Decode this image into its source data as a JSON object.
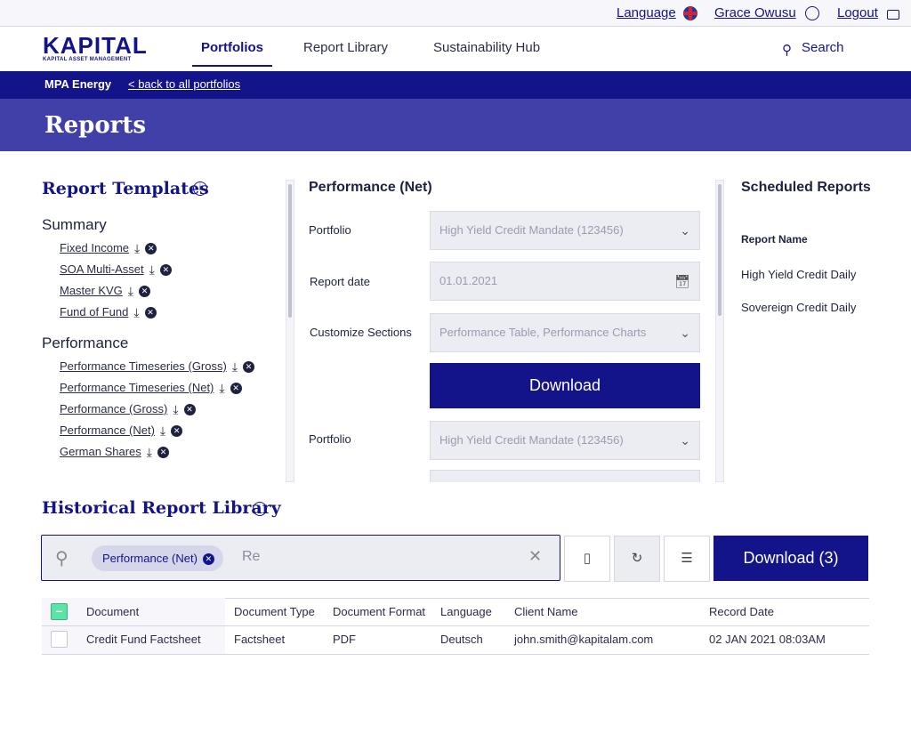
{
  "topbar": {
    "language": "Language",
    "user": "Grace Owusu",
    "logout": "Logout"
  },
  "nav": {
    "logo": "KAPITAL",
    "logo_sub": "KAPITAL ASSET MANAGEMENT",
    "items": [
      "Portfolios",
      "Report Library",
      "Sustainability Hub"
    ],
    "active": "Portfolios",
    "search": "Search"
  },
  "breadcrumb": {
    "current": "MPA Energy",
    "back": "< back to all portfolios"
  },
  "page_title": "Reports",
  "templates": {
    "title": "Report Templates",
    "groups": [
      {
        "name": "Summary",
        "items": [
          "Fixed Income",
          "SOA Multi-Asset",
          "Master KVG",
          "Fund of Fund"
        ]
      },
      {
        "name": "Performance",
        "items": [
          "Performance Timeseries (Gross)",
          "Performance Timeseries (Net)",
          "Performance (Gross)",
          "Performance (Net)",
          "German Shares"
        ]
      }
    ]
  },
  "form": {
    "title": "Performance (Net)",
    "portfolio_label": "Portfolio",
    "portfolio_value": "High Yield Credit Mandate (123456)",
    "date_label": "Report date",
    "date_value": "01.01.2021",
    "sections_label": "Customize Sections",
    "sections_value": "Performance Table, Performance Charts",
    "download": "Download",
    "portfolio2_label": "Portfolio",
    "portfolio2_value": "High Yield Credit Mandate (123456)"
  },
  "scheduled": {
    "title": "Scheduled Reports",
    "header": "Report Name",
    "items": [
      "High Yield Credit Daily",
      "Sovereign Credit Daily"
    ]
  },
  "history": {
    "title": "Historical Report Library",
    "chip": "Performance (Net)",
    "query": "Re",
    "download": "Download (3)",
    "columns": [
      "Document",
      "Document Type",
      "Document Format",
      "Language",
      "Client Name",
      "Record Date"
    ],
    "rows": [
      [
        "Credit Fund Factsheet",
        "Factsheet",
        "PDF",
        "Deutsch",
        "john.smith@kapitalam.com",
        "02 JAN 2021 08:03AM"
      ]
    ]
  },
  "colors": {
    "brand": "#14148a",
    "banner": "#4040a8",
    "check": "#5de3a8"
  }
}
